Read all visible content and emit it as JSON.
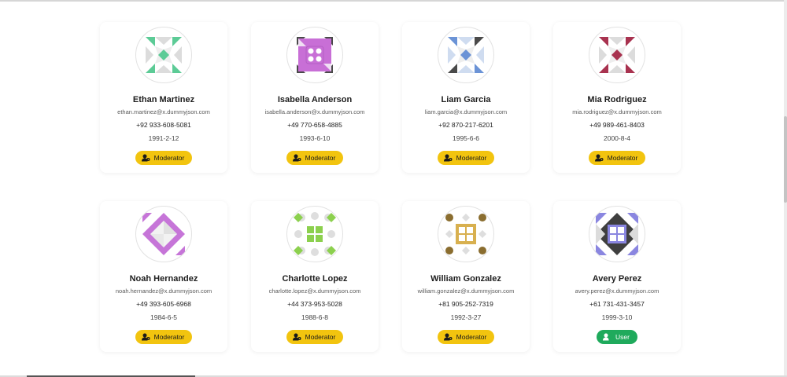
{
  "users": [
    {
      "name": "Ethan Martinez",
      "email": "ethan.martinez@x.dummyjson.com",
      "phone": "+92 933-608-5081",
      "birth_date": "1991-2-12",
      "role": "Moderator",
      "role_icon": "user-gear-icon",
      "avatar": {
        "pattern": "triangles-diamond",
        "color": "#5ccb96",
        "light": "#dcdcdc"
      }
    },
    {
      "name": "Isabella Anderson",
      "email": "isabella.anderson@x.dummyjson.com",
      "phone": "+49 770-658-4885",
      "birth_date": "1993-6-10",
      "role": "Moderator",
      "role_icon": "user-gear-icon",
      "avatar": {
        "pattern": "square-dots",
        "color": "#c86fd6",
        "dark": "#4a4a4a"
      }
    },
    {
      "name": "Liam Garcia",
      "email": "liam.garcia@x.dummyjson.com",
      "phone": "+92 870-217-6201",
      "birth_date": "1995-6-6",
      "role": "Moderator",
      "role_icon": "user-gear-icon",
      "avatar": {
        "pattern": "triangles-diamond",
        "color": "#6b93d6",
        "light": "#cfdcf0",
        "dark": "#4a4a4a"
      }
    },
    {
      "name": "Mia Rodriguez",
      "email": "mia.rodriguez@x.dummyjson.com",
      "phone": "+49 989-461-8403",
      "birth_date": "2000-8-4",
      "role": "Moderator",
      "role_icon": "user-gear-icon",
      "avatar": {
        "pattern": "triangles-diamond",
        "color": "#a8324f",
        "light": "#dcdcdc"
      }
    },
    {
      "name": "Noah Hernandez",
      "email": "noah.hernandez@x.dummyjson.com",
      "phone": "+49 393-605-6968",
      "birth_date": "1984-6-5",
      "role": "Moderator",
      "role_icon": "user-gear-icon",
      "avatar": {
        "pattern": "big-diamond",
        "color": "#c675d8",
        "light": "#e0e0e0"
      }
    },
    {
      "name": "Charlotte Lopez",
      "email": "charlotte.lopez@x.dummyjson.com",
      "phone": "+44 373-953-5028",
      "birth_date": "1988-6-8",
      "role": "Moderator",
      "role_icon": "user-gear-icon",
      "avatar": {
        "pattern": "grid-square",
        "color": "#8cd04e",
        "light": "#dedede"
      }
    },
    {
      "name": "William Gonzalez",
      "email": "william.gonzalez@x.dummyjson.com",
      "phone": "+81 905-252-7319",
      "birth_date": "1992-3-27",
      "role": "Moderator",
      "role_icon": "user-gear-icon",
      "avatar": {
        "pattern": "window-square",
        "color": "#d8b04f",
        "dark": "#8a6d2f",
        "light": "#dedede"
      }
    },
    {
      "name": "Avery Perez",
      "email": "avery.perez@x.dummyjson.com",
      "phone": "+61 731-431-3457",
      "birth_date": "1999-3-10",
      "role": "User",
      "role_icon": "user-icon",
      "avatar": {
        "pattern": "window-diamond",
        "color": "#8a86e0",
        "dark": "#3f3f3f",
        "light": "#dcdcdc"
      }
    }
  ],
  "colors": {
    "moderator_badge": "#f2c40f",
    "user_badge": "#1faa5c"
  }
}
